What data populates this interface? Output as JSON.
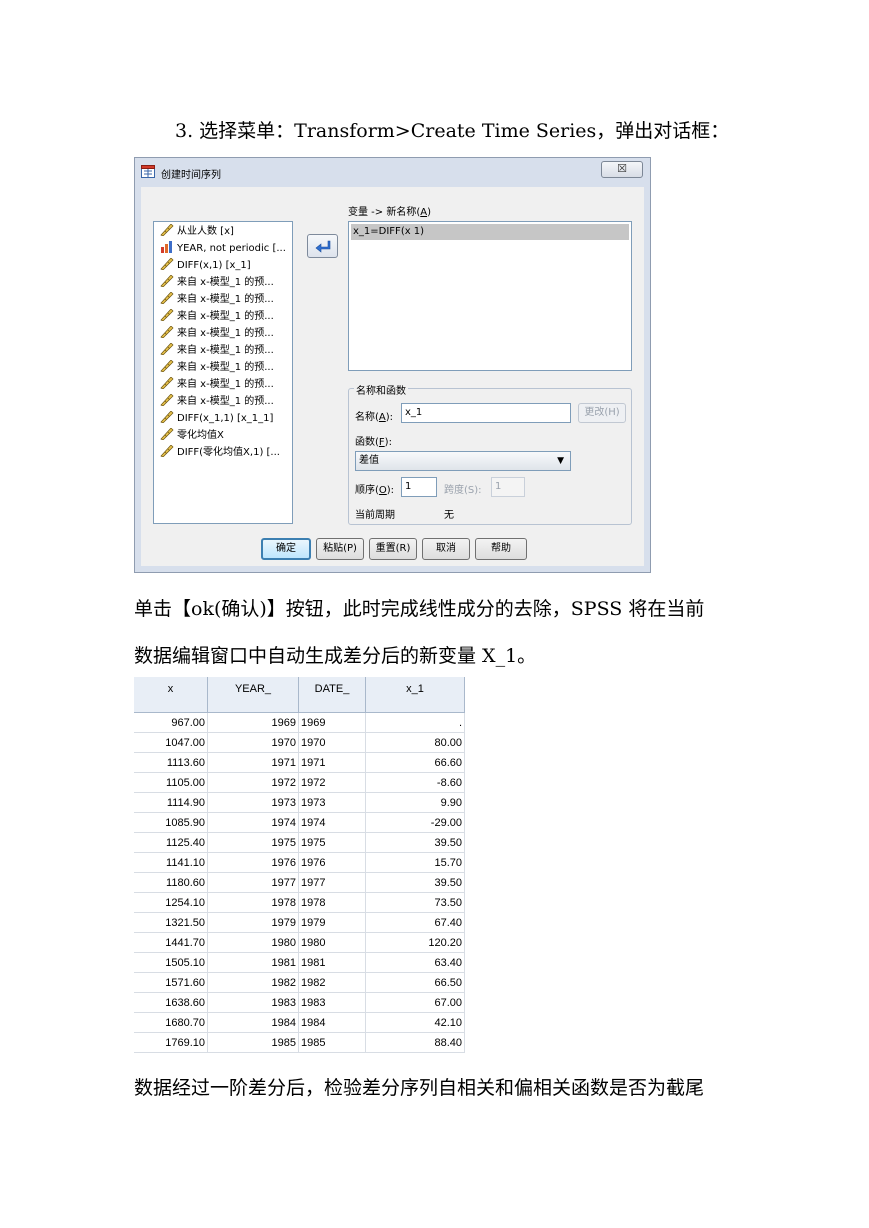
{
  "paragraphs": {
    "step": "3. 选择菜单：Transform>Create Time Series，弹出对话框：",
    "after1": "单击【ok(确认)】按钮，此时完成线性成分的去除，SPSS 将在当前",
    "after2": "数据编辑窗口中自动生成差分后的新变量 X_1。",
    "after3": "数据经过一阶差分后，检验差分序列自相关和偏相关函数是否为截尾"
  },
  "dialog": {
    "title": "创建时间序列",
    "close": "☒",
    "variables": [
      {
        "label": "从业人数 [x]",
        "icon": "ruler-icon"
      },
      {
        "label": "YEAR, not periodic [...",
        "icon": "nominal-bar-icon"
      },
      {
        "label": "DIFF(x,1) [x_1]",
        "icon": "ruler-icon"
      },
      {
        "label": "来自 x-模型_1 的预...",
        "icon": "ruler-icon"
      },
      {
        "label": "来自 x-模型_1 的预...",
        "icon": "ruler-icon"
      },
      {
        "label": "来自 x-模型_1 的预...",
        "icon": "ruler-icon"
      },
      {
        "label": "来自 x-模型_1 的预...",
        "icon": "ruler-icon"
      },
      {
        "label": "来自 x-模型_1 的预...",
        "icon": "ruler-icon"
      },
      {
        "label": "来自 x-模型_1 的预...",
        "icon": "ruler-icon"
      },
      {
        "label": "来自 x-模型_1 的预...",
        "icon": "ruler-icon"
      },
      {
        "label": "来自 x-模型_1 的预...",
        "icon": "ruler-icon"
      },
      {
        "label": "DIFF(x_1,1) [x_1_1]",
        "icon": "ruler-icon"
      },
      {
        "label": "零化均值X",
        "icon": "ruler-icon"
      },
      {
        "label": "DIFF(零化均值X,1) [...",
        "icon": "ruler-icon"
      }
    ],
    "target_label_pre": "变量 -> 新名称(",
    "target_label_key": "A",
    "target_label_post": ")",
    "target_items": [
      "x_1=DIFF(x 1)"
    ],
    "group_title": "名称和函数",
    "name_label_pre": "名称(",
    "name_label_key": "A",
    "name_label_post": "):",
    "name_value": "x_1",
    "change_button": "更改(H)",
    "function_label_pre": "函数(",
    "function_label_key": "F",
    "function_label_post": "):",
    "function_value": "差值",
    "order_label_pre": "顺序(",
    "order_label_key": "O",
    "order_label_post": "):",
    "order_value": "1",
    "span_label": "跨度(S):",
    "span_value": "1",
    "period_label": "当前周期",
    "period_value": "无",
    "buttons": {
      "ok": "确定",
      "paste": "粘贴(P)",
      "reset": "重置(R)",
      "cancel": "取消",
      "help": "帮助"
    }
  },
  "table": {
    "columns": [
      "x",
      "YEAR_",
      "DATE_",
      "x_1"
    ],
    "rows": [
      [
        "967.00",
        "1969",
        "1969",
        "."
      ],
      [
        "1047.00",
        "1970",
        "1970",
        "80.00"
      ],
      [
        "1113.60",
        "1971",
        "1971",
        "66.60"
      ],
      [
        "1105.00",
        "1972",
        "1972",
        "-8.60"
      ],
      [
        "1114.90",
        "1973",
        "1973",
        "9.90"
      ],
      [
        "1085.90",
        "1974",
        "1974",
        "-29.00"
      ],
      [
        "1125.40",
        "1975",
        "1975",
        "39.50"
      ],
      [
        "1141.10",
        "1976",
        "1976",
        "15.70"
      ],
      [
        "1180.60",
        "1977",
        "1977",
        "39.50"
      ],
      [
        "1254.10",
        "1978",
        "1978",
        "73.50"
      ],
      [
        "1321.50",
        "1979",
        "1979",
        "67.40"
      ],
      [
        "1441.70",
        "1980",
        "1980",
        "120.20"
      ],
      [
        "1505.10",
        "1981",
        "1981",
        "63.40"
      ],
      [
        "1571.60",
        "1982",
        "1982",
        "66.50"
      ],
      [
        "1638.60",
        "1983",
        "1983",
        "67.00"
      ],
      [
        "1680.70",
        "1984",
        "1984",
        "42.10"
      ],
      [
        "1769.10",
        "1985",
        "1985",
        "88.40"
      ]
    ]
  }
}
